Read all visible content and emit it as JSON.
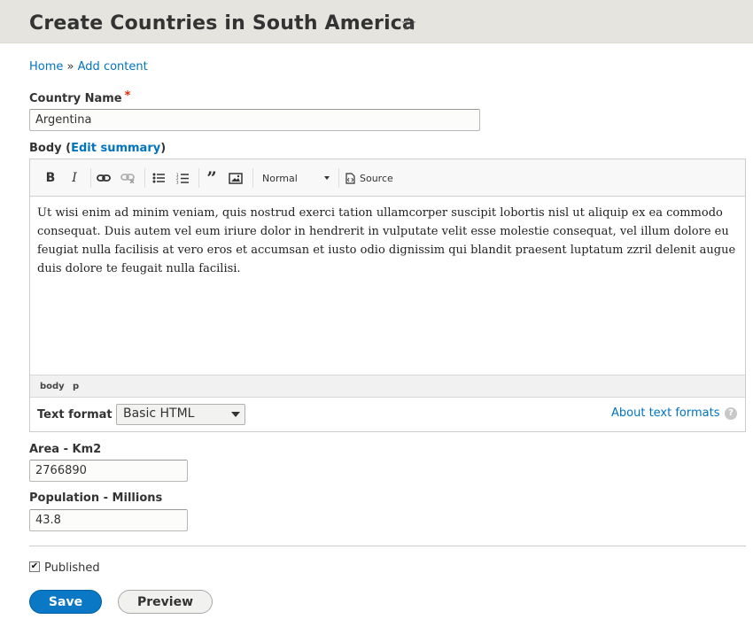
{
  "header": {
    "title": "Create Countries in South America",
    "favorite_icon": "star-outline-icon"
  },
  "breadcrumb": {
    "home": "Home",
    "separator": "»",
    "current": "Add content"
  },
  "country_name": {
    "label": "Country Name",
    "required": "*",
    "value": "Argentina"
  },
  "body": {
    "label": "Body",
    "summary_link": "Edit summary",
    "toolbar": {
      "format_select": "Normal",
      "source": "Source",
      "icons": [
        "bold-icon",
        "italic-icon",
        "link-icon",
        "unlink-icon",
        "bulleted-list-icon",
        "numbered-list-icon",
        "blockquote-icon",
        "image-icon",
        "source-icon"
      ]
    },
    "text": "Ut wisi enim ad minim veniam, quis nostrud exerci tation ullamcorper suscipit lobortis nisl ut aliquip ex ea commodo consequat. Duis autem vel eum iriure dolor in hendrerit in vulputate velit esse molestie consequat, vel illum dolore eu feugiat nulla facilisis at vero eros et accumsan et iusto odio dignissim qui blandit praesent luptatum zzril delenit augue duis dolore te feugait nulla facilisi.",
    "path": [
      "body",
      "p"
    ],
    "text_format_label": "Text format",
    "text_format_value": "Basic HTML",
    "about_formats": "About text formats"
  },
  "area": {
    "label": "Area - Km2",
    "value": "2766890"
  },
  "population": {
    "label": "Population - Millions",
    "value": "43.8"
  },
  "published": {
    "label": "Published",
    "checked": true
  },
  "actions": {
    "save": "Save",
    "preview": "Preview"
  },
  "colors": {
    "primary": "#0a78c4",
    "link": "#0074bd",
    "header_bg": "#e6e4df",
    "required": "#e32700"
  }
}
